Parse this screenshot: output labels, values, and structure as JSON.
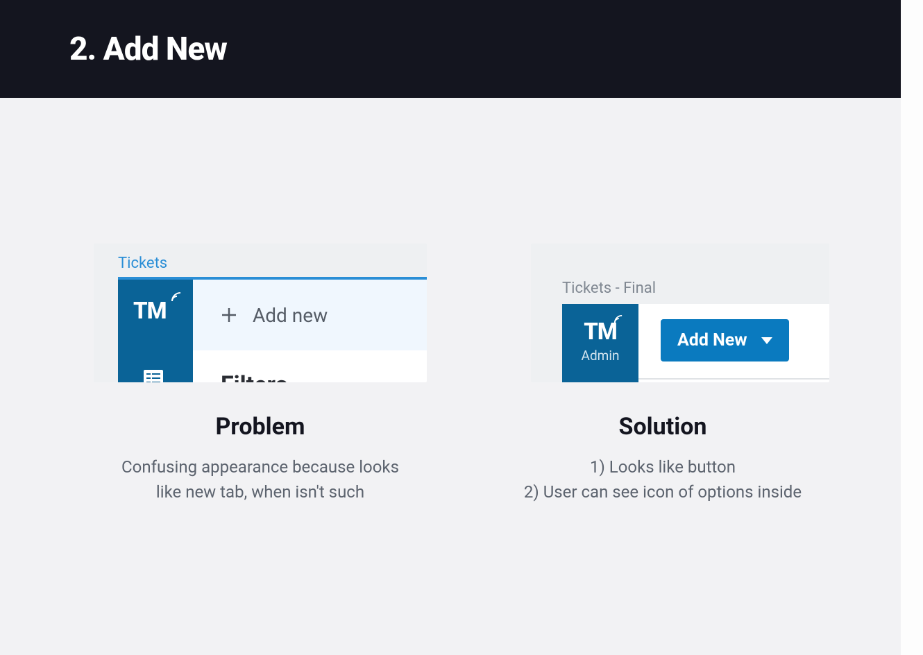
{
  "header": {
    "title": "2. Add New"
  },
  "problem": {
    "tab_label": "Tickets",
    "add_new_label": "Add new",
    "filters_label": "Filters",
    "caption_title": "Problem",
    "caption_line1": "Confusing appearance because looks",
    "caption_line2": "like new tab, when isn't such",
    "logo": "TM"
  },
  "solution": {
    "tab_label": "Tickets - Final",
    "admin_label": "Admin",
    "add_new_button": "Add New",
    "caption_title": "Solution",
    "caption_line1": "1) Looks like button",
    "caption_line2": "2) User can see icon of options inside",
    "logo": "TM"
  }
}
